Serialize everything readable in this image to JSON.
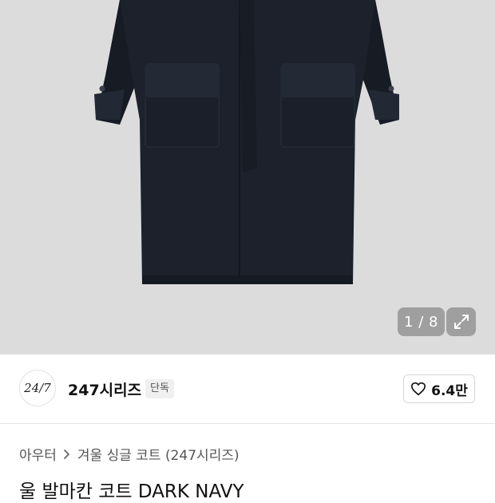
{
  "gallery": {
    "counter": "1 / 8",
    "expand_icon": "expand-icon",
    "background_color": "#dcdcdc"
  },
  "brand": {
    "logo_text": "24/7",
    "name": "247시리즈",
    "exclusive_badge": "단독",
    "like_count": "6.4만",
    "like_icon": "heart-outline-icon"
  },
  "breadcrumb": {
    "category": "아우터",
    "subcategory": "겨울 싱글 코트 (247시리즈)",
    "separator_icon": "chevron-right-icon"
  },
  "product": {
    "title": "울 발마칸 코트 DARK NAVY",
    "color": "#1c212b"
  }
}
